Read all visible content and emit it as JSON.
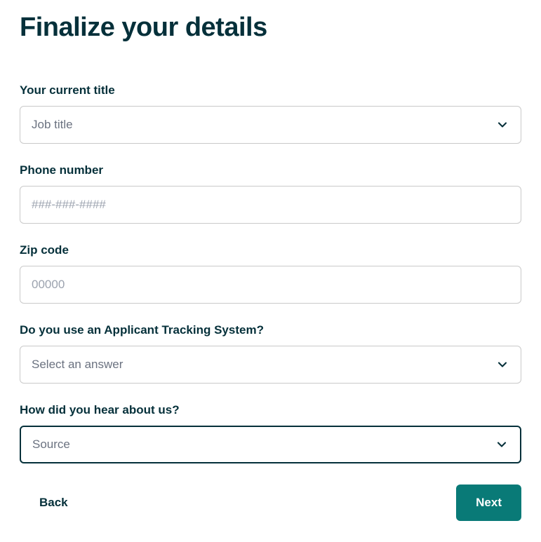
{
  "title": "Finalize your details",
  "fields": {
    "jobTitle": {
      "label": "Your current title",
      "placeholder": "Job title"
    },
    "phone": {
      "label": "Phone number",
      "placeholder": "###-###-####"
    },
    "zip": {
      "label": "Zip code",
      "placeholder": "00000"
    },
    "ats": {
      "label": "Do you use an Applicant Tracking System?",
      "placeholder": "Select an answer"
    },
    "source": {
      "label": "How did you hear about us?",
      "placeholder": "Source"
    }
  },
  "buttons": {
    "back": "Back",
    "next": "Next"
  }
}
